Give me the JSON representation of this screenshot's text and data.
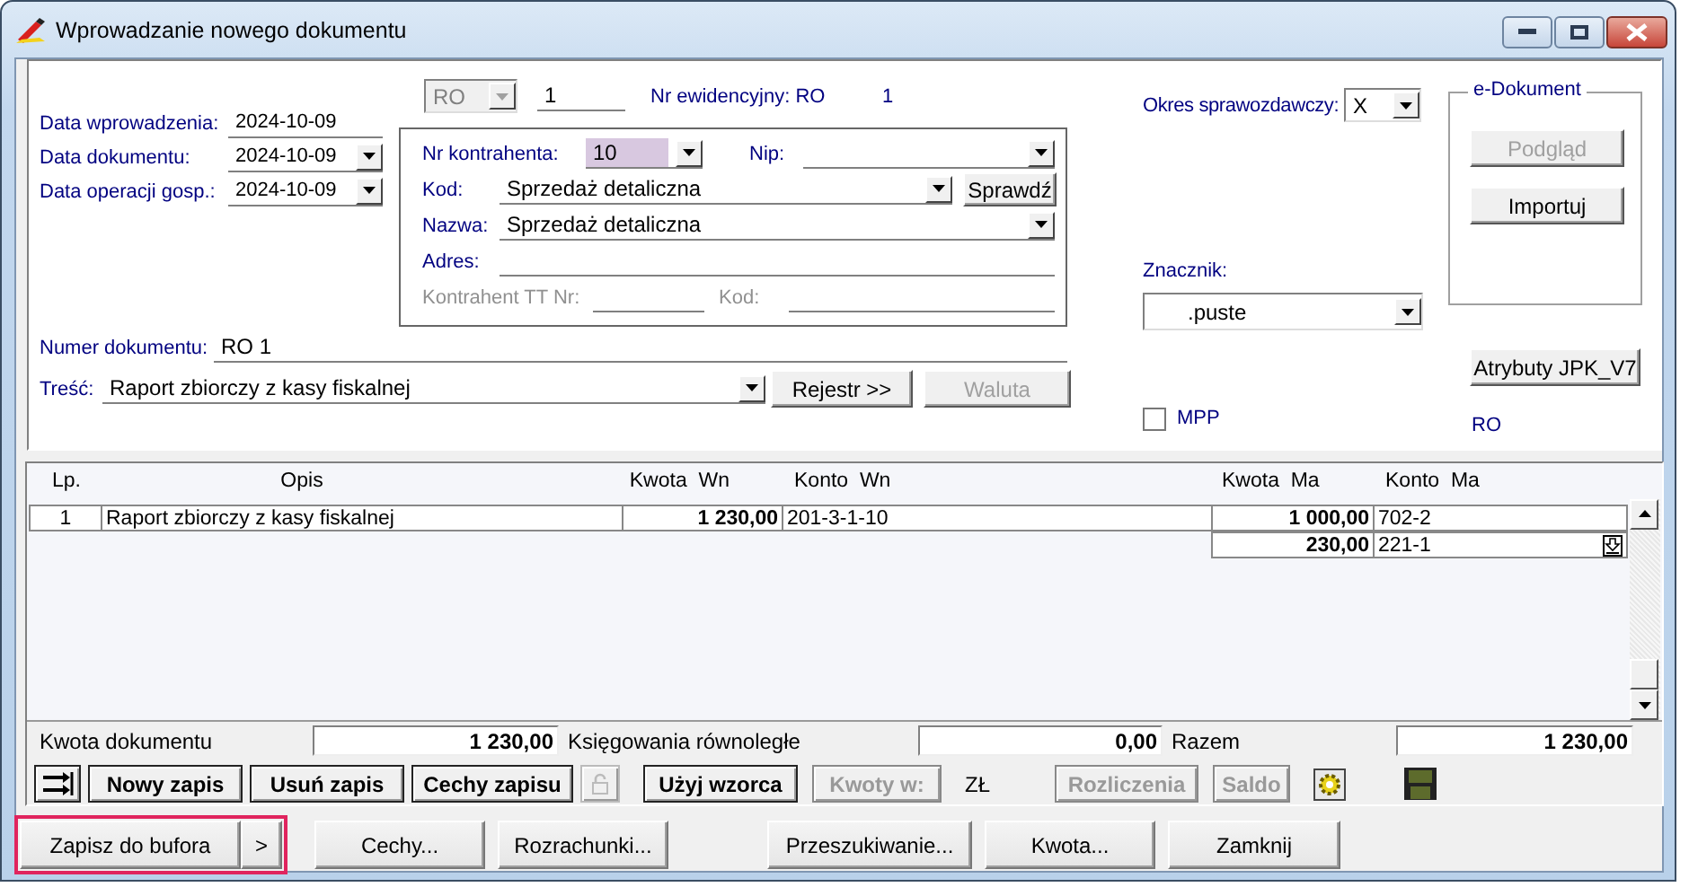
{
  "window": {
    "title": "Wprowadzanie nowego dokumentu"
  },
  "header": {
    "dates": [
      {
        "label": "Data wprowadzenia:",
        "value": "2024-10-09",
        "dropdown": false
      },
      {
        "label": "Data dokumentu:",
        "value": "2024-10-09",
        "dropdown": true
      },
      {
        "label": "Data operacji gosp.:",
        "value": "2024-10-09",
        "dropdown": true
      }
    ],
    "register": {
      "value": "RO",
      "disabled": true
    },
    "number": "1",
    "record_number_label": "Nr ewidencyjny: RO",
    "record_number": "1",
    "contractor": {
      "number_label": "Nr kontrahenta:",
      "number": "10",
      "focused": true,
      "nip_label": "Nip:",
      "code_label": "Kod:",
      "code": "Sprzedaż detaliczna",
      "check_button": "Sprawdź",
      "name_label": "Nazwa:",
      "name": "Sprzedaż detaliczna",
      "address_label": "Adres:",
      "tt_label": "Kontrahent TT Nr:",
      "tt_code_label": "Kod:"
    },
    "document_number_label": "Numer dokumentu:",
    "document_number": "RO 1",
    "content_label": "Treść:",
    "content": "Raport zbiorczy z kasy fiskalnej",
    "register_button": {
      "label": "Rejestr >>",
      "disabled": false
    },
    "currency_button": {
      "label": "Waluta",
      "disabled": true
    },
    "period_label": "Okres sprawozdawczy:",
    "period": "X",
    "marker_label": "Znacznik:",
    "marker": ".puste",
    "mpp": {
      "label": "MPP",
      "checked": false
    },
    "edocument": {
      "title": "e-Dokument",
      "buttons": [
        {
          "label": "Podgląd",
          "disabled": true
        },
        {
          "label": "Importuj",
          "disabled": false
        }
      ]
    },
    "jpk_button": {
      "label": "Atrybuty JPK_V7",
      "disabled": false
    },
    "register_code": "RO"
  },
  "table": {
    "columns": [
      "Lp.",
      "Opis",
      "Kwota  Wn",
      "Konto  Wn",
      "Kwota  Ma",
      "Konto  Ma"
    ],
    "rows": [
      {
        "lp": "1",
        "description": "Raport zbiorczy z kasy fiskalnej",
        "debit_amount": "1 230,00",
        "debit_account": "201-3-1-10",
        "credit_amount": "1 000,00",
        "credit_account": "702-2"
      },
      {
        "credit_amount": "230,00",
        "credit_account": "221-1"
      }
    ]
  },
  "totals": [
    {
      "label": "Kwota dokumentu",
      "value": "1 230,00"
    },
    {
      "label": "Księgowania równoległe",
      "value": "0,00"
    },
    {
      "label": "Razem",
      "value": "1 230,00"
    }
  ],
  "toolbar": [
    {
      "kind": "button",
      "label": "Nowy zapis",
      "disabled": false
    },
    {
      "kind": "button",
      "label": "Usuń zapis",
      "disabled": false
    },
    {
      "kind": "button",
      "label": "Cechy zapisu",
      "disabled": false
    },
    {
      "kind": "button",
      "label": "Użyj wzorca",
      "disabled": false
    },
    {
      "kind": "button",
      "label": "Kwoty w:",
      "disabled": true
    },
    {
      "kind": "text",
      "label": "ZŁ"
    },
    {
      "kind": "button",
      "label": "Rozliczenia",
      "disabled": true
    },
    {
      "kind": "button",
      "label": "Saldo",
      "disabled": true
    }
  ],
  "footer": {
    "left": [
      {
        "label": "Zapisz do bufora",
        "menu": ">",
        "highlighted": true
      },
      {
        "label": "Cechy..."
      },
      {
        "label": "Rozrachunki..."
      }
    ],
    "right": [
      {
        "label": "Przeszukiwanie..."
      },
      {
        "label": "Kwota..."
      },
      {
        "label": "Zamknij"
      }
    ]
  }
}
